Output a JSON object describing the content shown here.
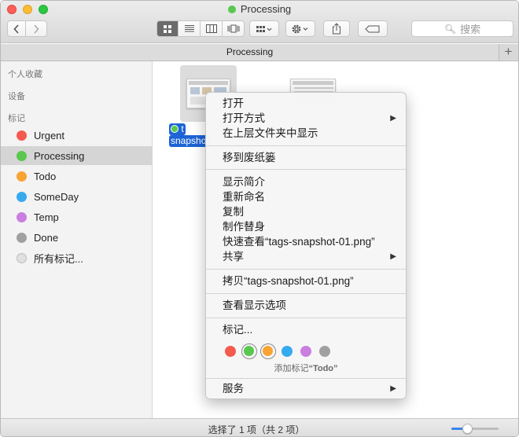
{
  "window": {
    "title": "Processing",
    "title_dot_color": "#5ac74f"
  },
  "toolbar": {
    "back_icon": "chevron-left-icon",
    "forward_icon": "chevron-right-icon",
    "view_modes": [
      "icon-view",
      "list-view",
      "column-view",
      "cover-flow-view"
    ],
    "search_placeholder": "搜索"
  },
  "tabbar": {
    "tab_label": "Processing",
    "add_label": "+"
  },
  "sidebar": {
    "sections": {
      "favorites": "个人收藏",
      "devices": "设备",
      "tags": "标记"
    },
    "tags": [
      {
        "label": "Urgent",
        "color": "#f55a4e"
      },
      {
        "label": "Processing",
        "color": "#5ac74f",
        "selected": true
      },
      {
        "label": "Todo",
        "color": "#f9a332"
      },
      {
        "label": "SomeDay",
        "color": "#35aaef"
      },
      {
        "label": "Temp",
        "color": "#c97ee0"
      },
      {
        "label": "Done",
        "color": "#a0a0a0"
      },
      {
        "label": "所有标记...",
        "color": "#e0e0e0"
      }
    ]
  },
  "files": [
    {
      "name_line1": "t",
      "name_line2": "snapshot",
      "selected": true
    },
    {
      "name_line1": "",
      "name_line2": "",
      "selected": false
    }
  ],
  "context_menu": {
    "open": "打开",
    "open_with": "打开方式",
    "show_in_enclosing": "在上层文件夹中显示",
    "move_to_trash": "移到废纸篓",
    "get_info": "显示简介",
    "rename": "重新命名",
    "duplicate": "复制",
    "make_alias": "制作替身",
    "quick_look": "快速查看“tags-snapshot-01.png”",
    "share": "共享",
    "copy": "拷贝“tags-snapshot-01.png”",
    "show_view_options": "查看显示选项",
    "tags": "标记...",
    "tag_colors": [
      "#f55a4e",
      "#5ac74f",
      "#f9a332",
      "#35aaef",
      "#c97ee0",
      "#a0a0a0"
    ],
    "tag_hint_prefix": "添加标记",
    "tag_hint_name": "“Todo”",
    "services": "服务"
  },
  "statusbar": {
    "text": "选择了 1 项（共 2 项）",
    "icon_size_level": 0.33
  }
}
